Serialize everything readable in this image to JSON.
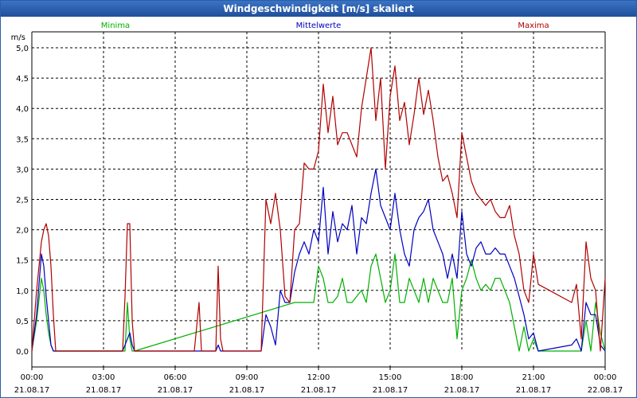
{
  "window": {
    "title": "Windgeschwindigkeit [m/s] skaliert"
  },
  "chart_data": {
    "type": "line",
    "title": "Windgeschwindigkeit [m/s] skaliert",
    "ylabel": "m/s",
    "ylim": [
      0,
      5.0
    ],
    "yticks": [
      "0,0",
      "0,5",
      "1,0",
      "1,5",
      "2,0",
      "2,5",
      "3,0",
      "3,5",
      "4,0",
      "4,5",
      "5,0"
    ],
    "xlim_hours": [
      0,
      24
    ],
    "xticks": [
      {
        "time": "00:00",
        "date": "21.08.17"
      },
      {
        "time": "03:00",
        "date": "21.08.17"
      },
      {
        "time": "06:00",
        "date": "21.08.17"
      },
      {
        "time": "09:00",
        "date": "21.08.17"
      },
      {
        "time": "12:00",
        "date": "21.08.17"
      },
      {
        "time": "15:00",
        "date": "21.08.17"
      },
      {
        "time": "18:00",
        "date": "21.08.17"
      },
      {
        "time": "21:00",
        "date": "21.08.17"
      },
      {
        "time": "00:00",
        "date": "22.08.17"
      }
    ],
    "grid": true,
    "legend": "top",
    "series": [
      {
        "name": "Minima",
        "color": "#00b000",
        "x": [
          0,
          0.2,
          0.4,
          0.5,
          0.6,
          0.7,
          0.8,
          0.9,
          1.0,
          1.2,
          3.9,
          4.0,
          4.1,
          4.2,
          4.3,
          11.0,
          11.2,
          11.4,
          11.6,
          11.8,
          12.0,
          12.2,
          12.4,
          12.6,
          12.8,
          13.0,
          13.2,
          13.4,
          13.6,
          13.8,
          14.0,
          14.2,
          14.4,
          14.6,
          14.8,
          15.0,
          15.2,
          15.4,
          15.6,
          15.8,
          16.0,
          16.2,
          16.4,
          16.6,
          16.8,
          17.0,
          17.2,
          17.4,
          17.6,
          17.8,
          18.0,
          18.2,
          18.4,
          18.6,
          18.8,
          19.0,
          19.2,
          19.4,
          19.6,
          19.8,
          20.0,
          20.2,
          20.4,
          20.6,
          20.8,
          21.0,
          21.2,
          23.0,
          23.2,
          23.4,
          23.6,
          23.8,
          24.0
        ],
        "values": [
          0,
          0.5,
          1.2,
          1.0,
          0.6,
          0.3,
          0.1,
          0,
          0,
          0,
          0,
          0.8,
          0.2,
          0,
          0,
          0.8,
          0.8,
          0.8,
          0.8,
          0.8,
          1.4,
          1.2,
          0.8,
          0.8,
          0.9,
          1.2,
          0.8,
          0.8,
          0.9,
          1.0,
          0.8,
          1.4,
          1.6,
          1.2,
          0.8,
          1.0,
          1.6,
          0.8,
          0.8,
          1.2,
          1.0,
          0.8,
          1.2,
          0.8,
          1.2,
          1.0,
          0.8,
          0.8,
          1.2,
          0.2,
          1.0,
          1.2,
          1.5,
          1.2,
          1.0,
          1.1,
          1.0,
          1.2,
          1.2,
          1.0,
          0.8,
          0.4,
          0,
          0.4,
          0,
          0.2,
          0,
          0,
          0.5,
          0,
          0.8,
          0.3,
          0
        ],
        "dense": true
      },
      {
        "name": "Mittelwerte",
        "color": "#0000c0",
        "x": [
          0,
          0.2,
          0.4,
          0.5,
          0.6,
          0.7,
          0.8,
          0.9,
          1.0,
          1.2,
          3.8,
          4.0,
          4.1,
          4.2,
          4.3,
          7.7,
          7.8,
          7.9,
          9.6,
          9.8,
          10.0,
          10.2,
          10.4,
          10.6,
          10.8,
          11.0,
          11.2,
          11.4,
          11.6,
          11.8,
          12.0,
          12.2,
          12.4,
          12.6,
          12.8,
          13.0,
          13.2,
          13.4,
          13.6,
          13.8,
          14.0,
          14.2,
          14.4,
          14.6,
          14.8,
          15.0,
          15.2,
          15.4,
          15.6,
          15.8,
          16.0,
          16.2,
          16.4,
          16.6,
          16.8,
          17.0,
          17.2,
          17.4,
          17.6,
          17.8,
          18.0,
          18.2,
          18.4,
          18.6,
          18.8,
          19.0,
          19.2,
          19.4,
          19.6,
          19.8,
          20.0,
          20.2,
          20.4,
          20.6,
          20.8,
          21.0,
          21.2,
          22.6,
          22.8,
          23.0,
          23.2,
          23.4,
          23.6,
          23.8,
          24.0
        ],
        "values": [
          0,
          0.6,
          1.6,
          1.4,
          0.9,
          0.5,
          0.1,
          0,
          0,
          0,
          0,
          0.2,
          0.3,
          0.1,
          0,
          0,
          0.1,
          0,
          0,
          0.6,
          0.4,
          0.1,
          1.0,
          0.8,
          0.8,
          1.3,
          1.6,
          1.8,
          1.6,
          2.0,
          1.8,
          2.7,
          1.6,
          2.3,
          1.8,
          2.1,
          2.0,
          2.4,
          1.6,
          2.2,
          2.1,
          2.6,
          3.0,
          2.4,
          2.2,
          2.0,
          2.6,
          2.0,
          1.6,
          1.4,
          2.0,
          2.2,
          2.3,
          2.5,
          2.0,
          1.8,
          1.6,
          1.2,
          1.6,
          1.2,
          2.3,
          1.6,
          1.4,
          1.7,
          1.8,
          1.6,
          1.6,
          1.7,
          1.6,
          1.6,
          1.4,
          1.2,
          0.9,
          0.6,
          0.2,
          0.3,
          0,
          0.1,
          0.2,
          0,
          0.8,
          0.6,
          0.6,
          0.1,
          0
        ],
        "dense": false
      },
      {
        "name": "Maxima",
        "color": "#b00000",
        "x": [
          0,
          0.2,
          0.4,
          0.5,
          0.6,
          0.7,
          0.8,
          0.9,
          1.0,
          1.2,
          3.8,
          3.9,
          4.0,
          4.1,
          4.2,
          4.3,
          6.8,
          7.0,
          7.1,
          7.2,
          7.7,
          7.8,
          7.9,
          8.0,
          9.6,
          9.8,
          10.0,
          10.2,
          10.4,
          10.6,
          10.8,
          11.0,
          11.2,
          11.4,
          11.6,
          11.8,
          12.0,
          12.2,
          12.4,
          12.6,
          12.8,
          13.0,
          13.2,
          13.4,
          13.6,
          13.8,
          14.0,
          14.2,
          14.4,
          14.6,
          14.8,
          15.0,
          15.2,
          15.4,
          15.6,
          15.8,
          16.0,
          16.2,
          16.4,
          16.6,
          16.8,
          17.0,
          17.2,
          17.4,
          17.6,
          17.8,
          18.0,
          18.2,
          18.4,
          18.6,
          18.8,
          19.0,
          19.2,
          19.4,
          19.6,
          19.8,
          20.0,
          20.2,
          20.4,
          20.6,
          20.8,
          21.0,
          21.2,
          22.6,
          22.8,
          23.0,
          23.2,
          23.4,
          23.6,
          23.8,
          24.0
        ],
        "values": [
          0,
          1.0,
          1.8,
          2.0,
          2.1,
          1.9,
          1.4,
          0.6,
          0,
          0,
          0,
          0.9,
          2.1,
          2.1,
          0.5,
          0,
          0,
          0.8,
          0,
          0,
          0,
          1.4,
          0.2,
          0,
          0,
          2.5,
          2.1,
          2.6,
          2.0,
          0.9,
          0.8,
          2.0,
          2.1,
          3.1,
          3.0,
          3.0,
          3.3,
          4.4,
          3.6,
          4.2,
          3.4,
          3.6,
          3.6,
          3.4,
          3.2,
          4.0,
          4.5,
          5.0,
          3.8,
          4.5,
          3.0,
          4.2,
          4.7,
          3.8,
          4.1,
          3.4,
          3.9,
          4.5,
          3.9,
          4.3,
          3.8,
          3.2,
          2.8,
          2.9,
          2.6,
          2.2,
          3.6,
          3.2,
          2.8,
          2.6,
          2.5,
          2.4,
          2.5,
          2.3,
          2.2,
          2.2,
          2.4,
          1.9,
          1.6,
          1.0,
          0.8,
          1.6,
          1.1,
          0.8,
          1.1,
          0.2,
          1.8,
          1.2,
          1.0,
          0,
          1.2
        ],
        "dense": false
      }
    ]
  }
}
